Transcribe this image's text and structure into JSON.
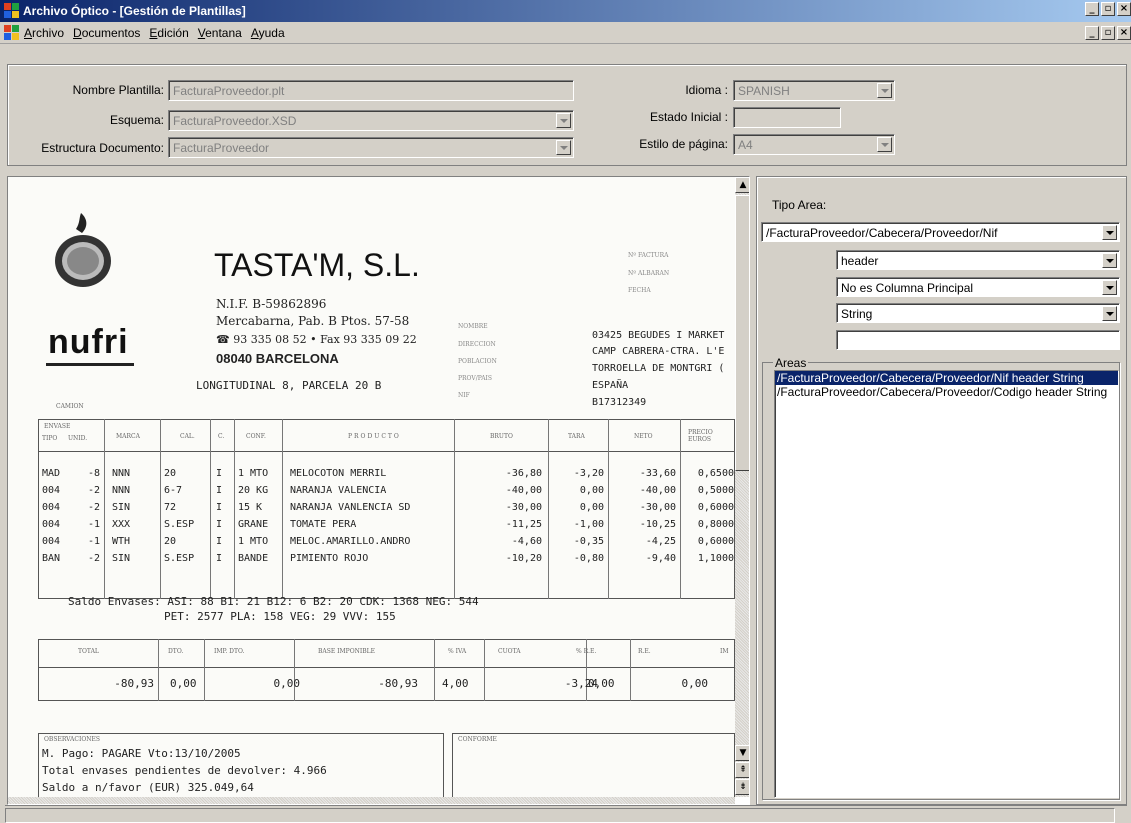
{
  "window": {
    "title": "Archivo Óptico - [Gestión de Plantillas]"
  },
  "menu": [
    "Archivo",
    "Documentos",
    "Edición",
    "Ventana",
    "Ayuda"
  ],
  "form": {
    "nombre_label": "Nombre Plantilla:",
    "nombre_value": "FacturaProveedor.plt",
    "esquema_label": "Esquema:",
    "esquema_value": "FacturaProveedor.XSD",
    "estructura_label": "Estructura Documento:",
    "estructura_value": "FacturaProveedor",
    "idioma_label": "Idioma :",
    "idioma_value": "SPANISH",
    "estado_label": "Estado Inicial :",
    "estado_value": "",
    "estilo_label": "Estilo de página:",
    "estilo_value": "A4"
  },
  "panel": {
    "tipo_area_label": "Tipo Area:",
    "tipo_area_value": "/FacturaProveedor/Cabecera/Proveedor/Nif",
    "section_value": "header",
    "columna_value": "No es Columna Principal",
    "tipo_dato_value": "String",
    "extra_value": "",
    "areas_label": "Areas",
    "areas": [
      "/FacturaProveedor/Cabecera/Proveedor/Nif header String",
      "/FacturaProveedor/Cabecera/Proveedor/Codigo header String"
    ]
  },
  "invoice": {
    "company": "TASTA'M, S.L.",
    "brand": "nufri",
    "nif": "N.I.F. B-59862896",
    "address1": "Mercabarna, Pab. B Ptos. 57-58",
    "phone": "☎ 93 335 08 52  •  Fax 93 335 09 22",
    "city": "08040 BARCELONA",
    "address2": "LONGITUDINAL 8, PARCELA 20 B",
    "meta_labels": [
      "Nº FACTURA",
      "Nº ALBARAN",
      "FECHA"
    ],
    "client_labels": [
      "NOMBRE",
      "DIRECCION",
      "POBLACION",
      "PROV/PAIS",
      "NIF"
    ],
    "client": [
      "03425 BEGUDES I MARKET",
      "CAMP CABRERA-CTRA. L'E",
      "TORROELLA DE MONTGRI (",
      "ESPAÑA",
      "B17312349"
    ],
    "camion": "CAMION",
    "headers": [
      "ENVASE",
      "TIPO",
      "UNID.",
      "MARCA",
      "CAL.",
      "C.",
      "CONF.",
      "PRODUCTO",
      "BRUTO",
      "TARA",
      "NETO",
      "PRECIO EUROS"
    ],
    "rows": [
      [
        "MAD",
        "-8",
        "NNN",
        "20",
        "I",
        "1 MTO",
        "MELOCOTON MERRIL",
        "-36,80",
        "-3,20",
        "-33,60",
        "0,6500"
      ],
      [
        "004",
        "-2",
        "NNN",
        "6-7",
        "I",
        "20 KG",
        "NARANJA VALENCIA",
        "-40,00",
        "0,00",
        "-40,00",
        "0,5000"
      ],
      [
        "004",
        "-2",
        "SIN",
        "72",
        "I",
        "15 K",
        "NARANJA VANLENCIA SD",
        "-30,00",
        "0,00",
        "-30,00",
        "0,6000"
      ],
      [
        "004",
        "-1",
        "XXX",
        "S.ESP",
        "I",
        "GRANE",
        "TOMATE PERA",
        "-11,25",
        "-1,00",
        "-10,25",
        "0,8000"
      ],
      [
        "004",
        "-1",
        "WTH",
        "20",
        "I",
        "1 MTO",
        "MELOC.AMARILLO.ANDRO",
        "-4,60",
        "-0,35",
        "-4,25",
        "0,6000"
      ],
      [
        "BAN",
        "-2",
        "SIN",
        "S.ESP",
        "I",
        "BANDE",
        "PIMIENTO ROJO",
        "-10,20",
        "-0,80",
        "-9,40",
        "1,1000"
      ]
    ],
    "saldo_line1": "Saldo Envases: ASI:    88   B1:   21   B12:    6   B2:    20   CDK:   1368   NEG:   544",
    "saldo_line2": "PET:  2577   PLA:   158   VEG:    29   VVV:   155",
    "totals_headers": [
      "TOTAL",
      "DTO.",
      "IMP. DTO.",
      "BASE IMPONIBLE",
      "% IVA",
      "CUOTA",
      "% R.E.",
      "R.E.",
      "IM"
    ],
    "totals_values": [
      "-80,93",
      "0,00",
      "0,00",
      "-80,93",
      "4,00",
      "-3,24",
      "0,00",
      "0,00"
    ],
    "obs_label": "OBSERVACIONES",
    "conforme_label": "CONFORME",
    "obs1": "M. Pago: PAGARE        Vto:13/10/2005",
    "obs2": "Total envases pendientes de devolver:   4.966",
    "obs3": "Saldo a n/favor (EUR)       325.049,64"
  }
}
